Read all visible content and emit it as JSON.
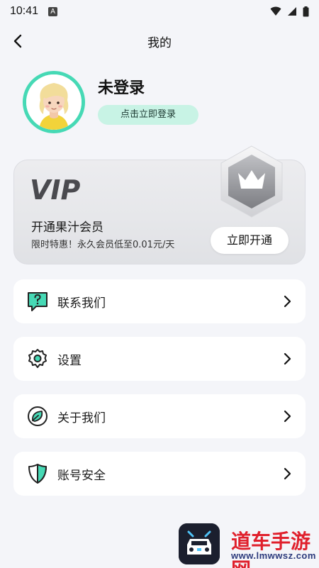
{
  "status_bar": {
    "time": "10:41",
    "notification_icon": "A"
  },
  "nav": {
    "title": "我的"
  },
  "profile": {
    "username": "未登录",
    "login_button": "点击立即登录"
  },
  "vip": {
    "logo_text": "VIP",
    "title": "开通果汁会员",
    "subtitle": "限时特惠！永久会员低至0.01元/天",
    "open_button": "立即开通"
  },
  "menu": [
    {
      "label": "联系我们",
      "icon": "chat-question-icon"
    },
    {
      "label": "设置",
      "icon": "gear-icon"
    },
    {
      "label": "关于我们",
      "icon": "leaf-icon"
    },
    {
      "label": "账号安全",
      "icon": "shield-icon"
    }
  ],
  "watermark": {
    "text": "道车手游网",
    "url": "www.lmwwsz.com"
  },
  "colors": {
    "accent": "#46d9b5",
    "login_bg": "#c8f3e5",
    "page_bg": "#f4f5f9",
    "watermark_red": "#e0202c"
  }
}
